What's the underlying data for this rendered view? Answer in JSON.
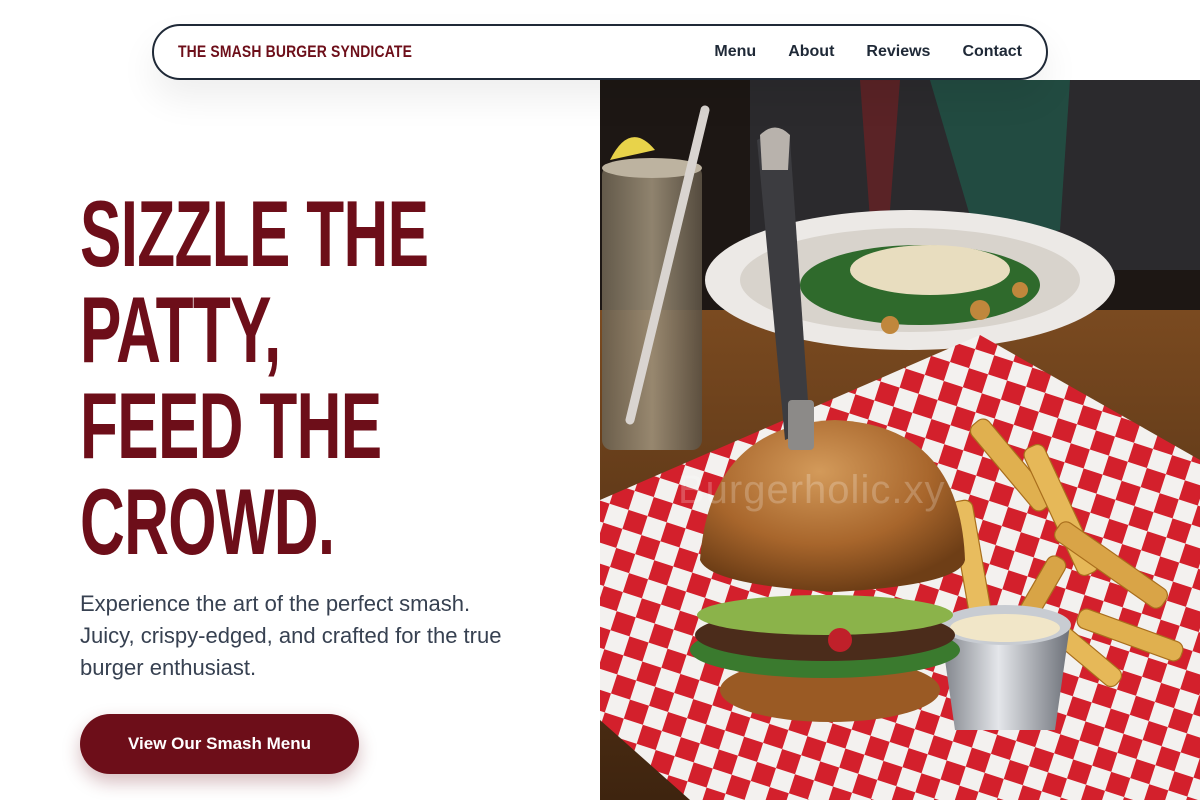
{
  "header": {
    "brand": "THE SMASH BURGER SYNDICATE",
    "nav": [
      "Menu",
      "About",
      "Reviews",
      "Contact"
    ]
  },
  "hero": {
    "title_lines": [
      "SIZZLE THE",
      "PATTY,",
      "FEED THE",
      "CROWD."
    ],
    "subtitle": "Experience the art of the perfect smash. Juicy, crispy-edged, and crafted for the true burger enthusiast.",
    "cta": "View Our Smash Menu"
  },
  "image": {
    "subject": "smash burger with fries on red checkered paper",
    "watermark": "Burgerholic.xy"
  },
  "colors": {
    "brand": "#6d0e19",
    "text_dark": "#1f2937",
    "text_body": "#374151",
    "background": "#ffffff"
  }
}
